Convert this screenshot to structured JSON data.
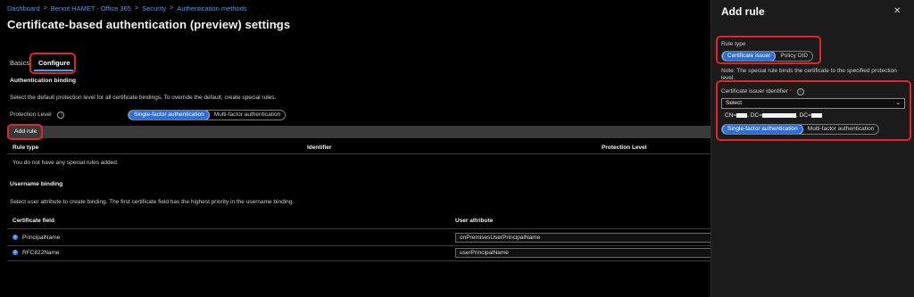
{
  "breadcrumb": {
    "items": [
      "Dashboard",
      "Benoit HAMET - Office 365",
      "Security",
      "Authentication methods"
    ],
    "separator": ">"
  },
  "page": {
    "title": "Certificate-based authentication (preview) settings",
    "more_label": "···"
  },
  "tabs": [
    {
      "label": "Basics",
      "active": false
    },
    {
      "label": "Configure",
      "active": true
    }
  ],
  "auth_binding": {
    "heading": "Authentication binding",
    "description": "Select the default protection level for all certificate bindings. To override the default, create special rules.",
    "protection_label": "Protection Level",
    "options": [
      "Single-factor authentication",
      "Multi-factor authentication"
    ],
    "selected": "Single-factor authentication",
    "add_rule_label": "Add rule",
    "columns": [
      "Rule type",
      "Identifier",
      "Protection Level"
    ],
    "empty_text": "You do not have any special rules added."
  },
  "username_binding": {
    "heading": "Username binding",
    "description": "Select user attribute to create binding. The first certificate field has the highest priority in the username binding.",
    "columns": [
      "Certificate field",
      "User attribute"
    ],
    "rows": [
      {
        "field": "PrincipalName",
        "attribute": "onPremisesUserPrincipalName"
      },
      {
        "field": "RFC822Name",
        "attribute": "userPrincipalName"
      }
    ]
  },
  "panel": {
    "title": "Add rule",
    "close_icon": "close-icon",
    "rule_type_label": "Rule type",
    "rule_type_options": [
      "Certificate issuer",
      "Policy OID"
    ],
    "rule_type_selected": "Certificate issuer",
    "note": "Note: The special rule binds the certificate to the specified protection level.",
    "issuer_label": "Certificate issuer identifier",
    "required_mark": "*",
    "select_value": "Select",
    "dropdown_option": {
      "cn": "CN=",
      "dc1": ", DC=",
      "dc2": ", DC="
    },
    "protection_options": [
      "Single-factor authentication",
      "Multi-factor authentication"
    ],
    "protection_selected": "Single-factor authentication"
  },
  "colors": {
    "accent": "#4f9bf0",
    "highlight": "#e0242a",
    "selected_pill": "#2f6fd1",
    "background": "#000000",
    "panel_bg": "#1b1b1b"
  }
}
